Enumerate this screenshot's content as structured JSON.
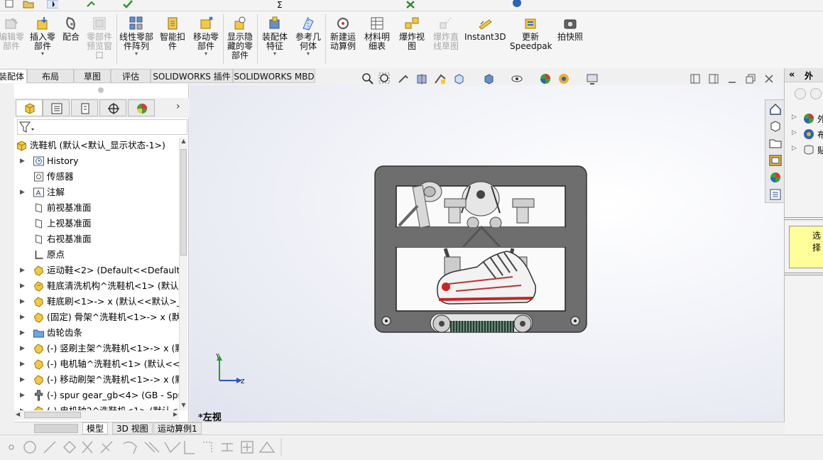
{
  "ribbon": {
    "buttons": [
      {
        "label": "编辑零\n部件",
        "disabled": true,
        "icon": "edit-component-icon"
      },
      {
        "label": "插入零\n部件",
        "disabled": false,
        "icon": "insert-component-icon"
      },
      {
        "label": "配合",
        "disabled": false,
        "icon": "mate-icon"
      },
      {
        "label": "零部件\n预览窗\n口",
        "disabled": true,
        "icon": "component-preview-icon"
      },
      {
        "label": "线性零部\n件阵列",
        "disabled": false,
        "icon": "linear-pattern-icon"
      },
      {
        "label": "智能扣\n件",
        "disabled": false,
        "icon": "smart-fasteners-icon"
      },
      {
        "label": "移动零\n部件",
        "disabled": false,
        "icon": "move-component-icon"
      },
      {
        "label": "显示隐\n藏的零\n部件",
        "disabled": false,
        "icon": "show-hidden-icon"
      },
      {
        "label": "装配体\n特征",
        "disabled": false,
        "icon": "assembly-feature-icon"
      },
      {
        "label": "参考几\n何体",
        "disabled": false,
        "icon": "reference-geometry-icon"
      },
      {
        "label": "新建运\n动算例",
        "disabled": false,
        "icon": "new-motion-study-icon"
      },
      {
        "label": "材料明\n细表",
        "disabled": false,
        "icon": "bill-of-materials-icon"
      },
      {
        "label": "爆炸视\n图",
        "disabled": false,
        "icon": "exploded-view-icon"
      },
      {
        "label": "爆炸直\n线草图",
        "disabled": true,
        "icon": "explode-line-sketch-icon"
      },
      {
        "label": "Instant3D",
        "disabled": false,
        "icon": "instant3d-icon"
      },
      {
        "label": "更新\nSpeedpak",
        "disabled": false,
        "icon": "update-speedpak-icon"
      },
      {
        "label": "拍快照",
        "disabled": false,
        "icon": "snapshot-icon"
      }
    ]
  },
  "command_tabs": [
    "装配体",
    "布局",
    "草图",
    "评估",
    "SOLIDWORKS 插件",
    "SOLIDWORKS MBD"
  ],
  "tree": {
    "items": [
      {
        "label": "洗鞋机 (默认<默认_显示状态-1>)",
        "icon": "assembly-icon",
        "expandable": false
      },
      {
        "label": "History",
        "icon": "history-icon",
        "expandable": true
      },
      {
        "label": "传感器",
        "icon": "sensor-icon",
        "expandable": false
      },
      {
        "label": "注解",
        "icon": "annotation-icon",
        "expandable": true
      },
      {
        "label": "前视基准面",
        "icon": "plane-icon",
        "expandable": false
      },
      {
        "label": "上视基准面",
        "icon": "plane-icon",
        "expandable": false
      },
      {
        "label": "右视基准面",
        "icon": "plane-icon",
        "expandable": false
      },
      {
        "label": "原点",
        "icon": "origin-icon",
        "expandable": false
      },
      {
        "label": "运动鞋<2> (Default<<Default>_",
        "icon": "part-icon",
        "expandable": true
      },
      {
        "label": "鞋底清洗机构^洗鞋机<1> (默认<",
        "icon": "subassembly-icon",
        "expandable": true
      },
      {
        "label": "鞋底刷<1>-> x (默认<<默认>_显",
        "icon": "part-icon",
        "expandable": true
      },
      {
        "label": "(固定) 骨架^洗鞋机<1>-> x (默认",
        "icon": "part-icon",
        "expandable": true
      },
      {
        "label": "齿轮齿条",
        "icon": "folder-icon",
        "expandable": true
      },
      {
        "label": "(-) 竖刷主架^洗鞋机<1>-> x (默认",
        "icon": "part-icon",
        "expandable": true
      },
      {
        "label": "(-) 电机轴^洗鞋机<1> (默认<<默",
        "icon": "part-icon",
        "expandable": true
      },
      {
        "label": "(-) 移动刷架^洗鞋机<1>-> x (默认",
        "icon": "part-icon",
        "expandable": true
      },
      {
        "label": "(-) spur gear_gb<4> (GB - Spur",
        "icon": "toolbox-part-icon",
        "expandable": true
      },
      {
        "label": "(-) 电机轴2^洗鞋机<1> (默认<<",
        "icon": "part-icon",
        "expandable": true
      }
    ]
  },
  "doc_tabs": [
    "模型",
    "3D 视图",
    "运动算例1"
  ],
  "viewport": {
    "view_name": "*左视",
    "triad": {
      "y": "Y",
      "z": "Z"
    }
  },
  "right_pane": {
    "header": "外",
    "tree_partial": [
      "外",
      "布",
      "贴"
    ],
    "tip_text": "选择"
  },
  "colors": {
    "accent": "#1f5fa8",
    "frame": "#6b6b6b",
    "tip": "#ffff99"
  }
}
